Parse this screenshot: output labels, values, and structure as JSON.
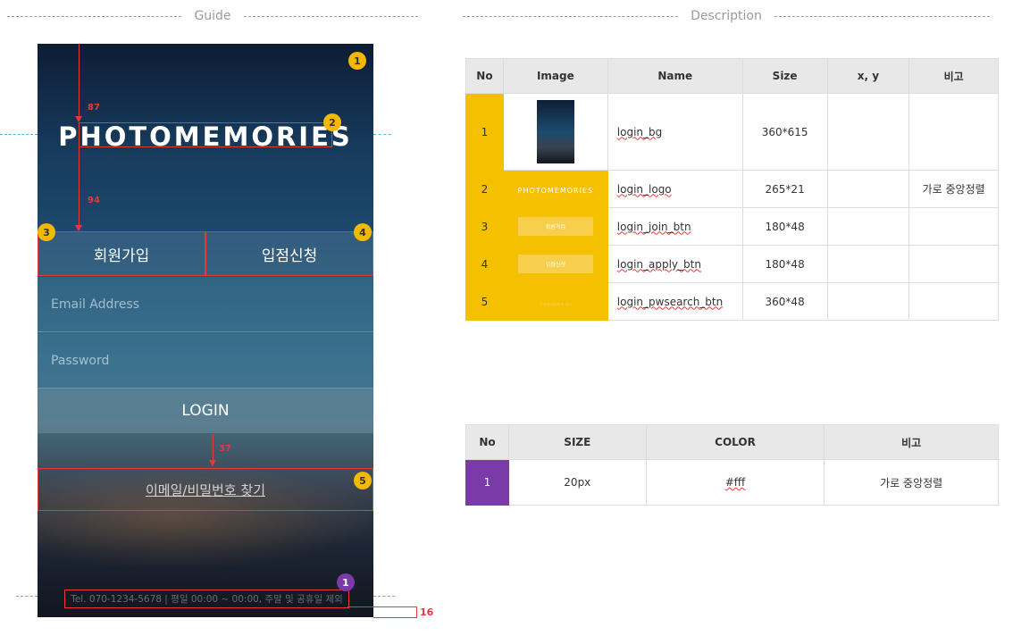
{
  "headings": {
    "guide": "Guide",
    "description": "Description"
  },
  "phone": {
    "logo": "PHOTOMEMORIES",
    "tabs": [
      "회원가입",
      "입점신청"
    ],
    "email_placeholder": "Email Address",
    "password_placeholder": "Password",
    "login_label": "LOGIN",
    "pwsearch_label": "이메일/비밀번호 찾기",
    "footer": "Tel. 070-1234-5678  |  평일 00:00 ~ 00:00, 주말 및 공휴일 제외"
  },
  "guides": {
    "measures": [
      "87",
      "94",
      "37",
      "16"
    ],
    "badges": [
      "1",
      "2",
      "3",
      "4",
      "5",
      "1"
    ]
  },
  "image_table": {
    "headers": [
      "No",
      "Image",
      "Name",
      "Size",
      "x, y",
      "비고"
    ],
    "rows": [
      {
        "no": "1",
        "name": "login_bg",
        "size": "360*615",
        "xy": "",
        "note": ""
      },
      {
        "no": "2",
        "thumb_text": "PHOTOMEMORIES",
        "name": "login_logo",
        "size": "265*21",
        "xy": "",
        "note": "가로 중앙정렬"
      },
      {
        "no": "3",
        "thumb_text": "회원가입",
        "name": "login_join_btn",
        "size": "180*48",
        "xy": "",
        "note": ""
      },
      {
        "no": "4",
        "thumb_text": "입점신청",
        "name": "login_apply_btn",
        "size": "180*48",
        "xy": "",
        "note": ""
      },
      {
        "no": "5",
        "thumb_text": "이메일/비밀번호 찾기",
        "name": "login_pwsearch_btn",
        "size": "360*48",
        "xy": "",
        "note": ""
      }
    ]
  },
  "text_table": {
    "headers": [
      "No",
      "SIZE",
      "COLOR",
      "비고"
    ],
    "rows": [
      {
        "no": "1",
        "size": "20px",
        "color": "#fff",
        "note": "가로 중앙정렬"
      }
    ]
  },
  "colors": {
    "marker_yellow": "#f5c000",
    "marker_purple": "#7a3aa8",
    "guide_red": "#e53935"
  }
}
